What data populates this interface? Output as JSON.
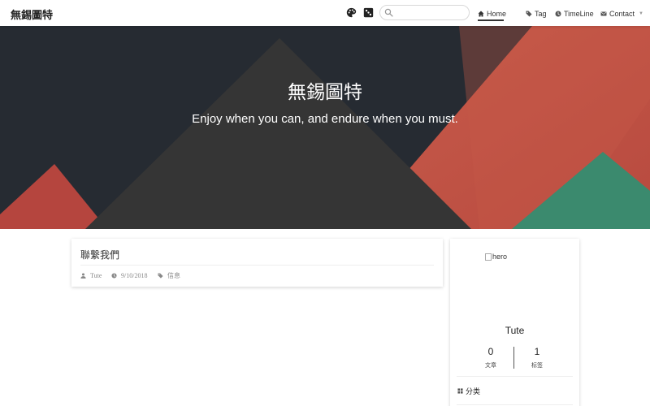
{
  "header": {
    "brand": "無錫圖特",
    "search": {
      "value": "",
      "placeholder": ""
    },
    "nav": {
      "home": "Home",
      "tag": "Tag",
      "timeline": "TimeLine",
      "contact": "Contact"
    }
  },
  "hero": {
    "title": "無錫圖特",
    "subtitle": "Enjoy when you can, and endure when you must."
  },
  "post": {
    "title": "聯繫我們",
    "author": "Tute",
    "date": "9/10/2018",
    "tag": "信息"
  },
  "sidebar": {
    "image_alt": "hero",
    "name": "Tute",
    "stats": {
      "posts_count": "0",
      "posts_label": "文章",
      "tags_count": "1",
      "tags_label": "标签"
    },
    "category_heading": "分类"
  },
  "icons": {
    "theme": "palette-icon",
    "random": "dice-icon",
    "search": "search-icon",
    "home": "home-icon",
    "tag": "tag-icon",
    "timeline": "clock-icon",
    "contact": "envelope-icon",
    "author": "user-icon",
    "date": "clock-icon",
    "category": "grid-icon"
  },
  "colors": {
    "hero_dark": "#262b32",
    "mountain_dark": "#353535",
    "mountain_red": "#c45a4a",
    "mountain_red_left": "#b5453e",
    "mountain_green": "#3b8a6e"
  }
}
